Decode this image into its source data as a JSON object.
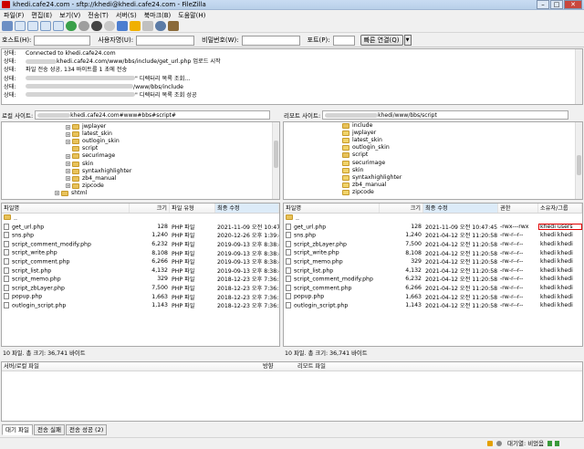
{
  "window": {
    "title": "khedi.cafe24.com - sftp://khedi@khedi.cafe24.com - FileZilla"
  },
  "menu": [
    "파일(F)",
    "편집(E)",
    "보기(V)",
    "전송(T)",
    "서버(S)",
    "북마크(B)",
    "도움말(H)"
  ],
  "quickconnect": {
    "host_label": "호스트(H):",
    "user_label": "사용자명(U):",
    "pass_label": "비밀번호(W):",
    "port_label": "포트(P):",
    "connect_button": "빠른 연결(Q)",
    "dropdown": "▼"
  },
  "log": [
    {
      "label": "상태:",
      "text": "Connected to khedi.cafe24.com"
    },
    {
      "label": "상태:",
      "text": "khedi.cafe24.com/www/bbs/include/get_url.php 업로드 시작"
    },
    {
      "label": "상태:",
      "text": "파일 전송 성공, 134 바이트를 1 초에 전송"
    },
    {
      "label": "상태:",
      "text": "\" 디렉터리 목록 조회..."
    },
    {
      "label": "상태:",
      "text": "/www/bbs/include"
    },
    {
      "label": "상태:",
      "text": "\" 디렉터리 목록 조회 성공"
    }
  ],
  "local": {
    "site_label": "로컬 사이트:",
    "site_path": "khedi.cafe24.com#www#bbs#script#",
    "tree": [
      "jwplayer",
      "latest_skin",
      "outlogin_skin",
      "script",
      "securimage",
      "skin",
      "syntaxhighlighter",
      "zb4_manual",
      "zipcode",
      "shtml"
    ],
    "headers": [
      "파일명",
      "크기",
      "파일 유형",
      "최종 수정"
    ],
    "files": [
      {
        "name": "..",
        "size": "",
        "type": "",
        "date": ""
      },
      {
        "name": "get_url.php",
        "size": "128",
        "type": "PHP 파일",
        "date": "2021-11-09 오전 10:47"
      },
      {
        "name": "sns.php",
        "size": "1,240",
        "type": "PHP 파일",
        "date": "2020-12-26 오후 1:39:4"
      },
      {
        "name": "script_comment_modify.php",
        "size": "6,232",
        "type": "PHP 파일",
        "date": "2019-09-13 오후 8:38:4"
      },
      {
        "name": "script_write.php",
        "size": "8,108",
        "type": "PHP 파일",
        "date": "2019-09-13 오후 8:38:4"
      },
      {
        "name": "script_comment.php",
        "size": "6,266",
        "type": "PHP 파일",
        "date": "2019-09-13 오후 8:38:4"
      },
      {
        "name": "script_list.php",
        "size": "4,132",
        "type": "PHP 파일",
        "date": "2019-09-13 오후 8:38:4"
      },
      {
        "name": "script_memo.php",
        "size": "329",
        "type": "PHP 파일",
        "date": "2018-12-23 오후 7:36:5"
      },
      {
        "name": "script_zbLayer.php",
        "size": "7,500",
        "type": "PHP 파일",
        "date": "2018-12-23 오후 7:36:5"
      },
      {
        "name": "popup.php",
        "size": "1,663",
        "type": "PHP 파일",
        "date": "2018-12-23 오후 7:36:5"
      },
      {
        "name": "outlogin_script.php",
        "size": "1,143",
        "type": "PHP 파일",
        "date": "2018-12-23 오후 7:36:5"
      }
    ],
    "status": "10 파일. 총 크기: 36,741 바이트"
  },
  "remote": {
    "site_label": "리모트 사이트:",
    "site_path": "khedi/www/bbs/script",
    "tree": [
      "include",
      "jwplayer",
      "latest_skin",
      "outlogin_skin",
      "script",
      "securimage",
      "skin",
      "syntaxhighlighter",
      "zb4_manual",
      "zipcode"
    ],
    "headers": [
      "파일명",
      "크기",
      "최종 수정",
      "권한",
      "소유자/그룹"
    ],
    "files": [
      {
        "name": "..",
        "size": "",
        "date": "",
        "perm": "",
        "owner": ""
      },
      {
        "name": "get_url.php",
        "size": "128",
        "date": "2021-11-09 오전 10:47:45",
        "perm": "-rwx---rwx",
        "owner": "khedi users"
      },
      {
        "name": "sns.php",
        "size": "1,240",
        "date": "2021-04-12 오전 11:20:58",
        "perm": "-rw-r--r--",
        "owner": "khedi khedi"
      },
      {
        "name": "script_zbLayer.php",
        "size": "7,500",
        "date": "2021-04-12 오전 11:20:58",
        "perm": "-rw-r--r--",
        "owner": "khedi khedi"
      },
      {
        "name": "script_write.php",
        "size": "8,108",
        "date": "2021-04-12 오전 11:20:58",
        "perm": "-rw-r--r--",
        "owner": "khedi khedi"
      },
      {
        "name": "script_memo.php",
        "size": "329",
        "date": "2021-04-12 오전 11:20:58",
        "perm": "-rw-r--r--",
        "owner": "khedi khedi"
      },
      {
        "name": "script_list.php",
        "size": "4,132",
        "date": "2021-04-12 오전 11:20:58",
        "perm": "-rw-r--r--",
        "owner": "khedi khedi"
      },
      {
        "name": "script_comment_modify.php",
        "size": "6,232",
        "date": "2021-04-12 오전 11:20:58",
        "perm": "-rw-r--r--",
        "owner": "khedi khedi"
      },
      {
        "name": "script_comment.php",
        "size": "6,266",
        "date": "2021-04-12 오전 11:20:58",
        "perm": "-rw-r--r--",
        "owner": "khedi khedi"
      },
      {
        "name": "popup.php",
        "size": "1,663",
        "date": "2021-04-12 오전 11:20:58",
        "perm": "-rw-r--r--",
        "owner": "khedi khedi"
      },
      {
        "name": "outlogin_script.php",
        "size": "1,143",
        "date": "2021-04-12 오전 11:20:58",
        "perm": "-rw-r--r--",
        "owner": "khedi khedi"
      }
    ],
    "status": "10 파일. 총 크기: 36,741 바이트",
    "highlight_color": "#e00000"
  },
  "queue": {
    "headers": [
      "서버/로컬 파일",
      "방향",
      "리모트 파일"
    ]
  },
  "tabs": [
    "대기 파일",
    "전송 실패",
    "전송 성공 (2)"
  ],
  "statusbar": {
    "queue_text": "대기열: 비었음"
  }
}
